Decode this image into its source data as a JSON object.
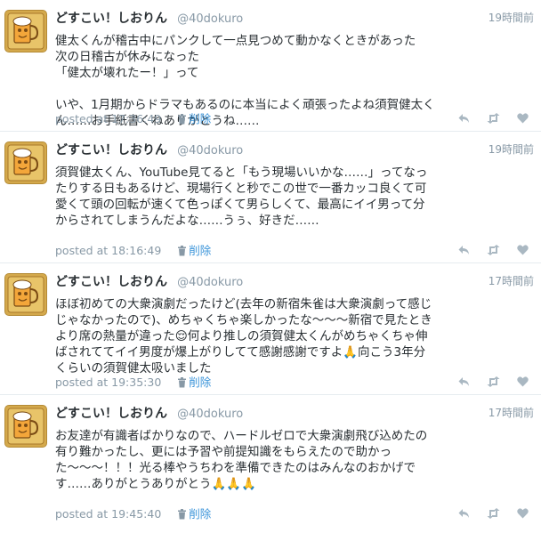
{
  "tweets": [
    {
      "name": "どすこい！しおりん",
      "handle": "@40dokuro",
      "time_ago": "19時間前",
      "text": "健太くんが稽古中にパンクして一点見つめて動かなくときがあった\n次の日稽古が休みになった\n「健太が壊れたー！」って\n\nいや、1月期からドラマもあるのに本当によく頑張ったよね須賀健太くん……お手紙書くねありがとうね……",
      "posted": "posted at 17:36:49",
      "delete_label": "削除"
    },
    {
      "name": "どすこい！しおりん",
      "handle": "@40dokuro",
      "time_ago": "19時間前",
      "text": "須賀健太くん、YouTube見てると「もう現場いいかな……」ってなったりする日もあるけど、現場行くと秒でこの世で一番カッコ良くて可愛くて頭の回転が速くて色っぽくて男らしくて、最高にイイ男って分からされてしまうんだよな……うぅ、好きだ……",
      "posted": "posted at 18:16:49",
      "delete_label": "削除"
    },
    {
      "name": "どすこい！しおりん",
      "handle": "@40dokuro",
      "time_ago": "17時間前",
      "text": "ほぼ初めての大衆演劇だったけど(去年の新宿朱雀は大衆演劇って感じじゃなかったので)、めちゃくちゃ楽しかったな〜〜〜新宿で見たときより席の熱量が違った😌何より推しの須賀健太くんがめちゃくちゃ伸ばされててイイ男度が爆上がりしてて感謝感謝ですよ🙏向こう3年分くらいの須賀健太吸いました",
      "posted": "posted at 19:35:30",
      "delete_label": "削除"
    },
    {
      "name": "どすこい！しおりん",
      "handle": "@40dokuro",
      "time_ago": "17時間前",
      "text": "お友達が有識者ばかりなので、ハードルゼロで大衆演劇飛び込めたの有り難かったし、更には予習や前提知識をもらえたので助かった〜〜〜！！！光る棒やうちわを準備できたのはみんなのおかげです……ありがとうありがとう🙏🙏🙏",
      "posted": "posted at 19:45:40",
      "delete_label": "削除"
    }
  ],
  "icons": {
    "avatar": "beer-mug-avatar",
    "trash": "trash-icon",
    "reply": "reply-icon",
    "retweet": "retweet-icon",
    "like": "heart-icon"
  },
  "colors": {
    "link": "#3b94d9",
    "muted": "#8899a6",
    "text": "#292f33",
    "divider": "#e6ecf0"
  }
}
